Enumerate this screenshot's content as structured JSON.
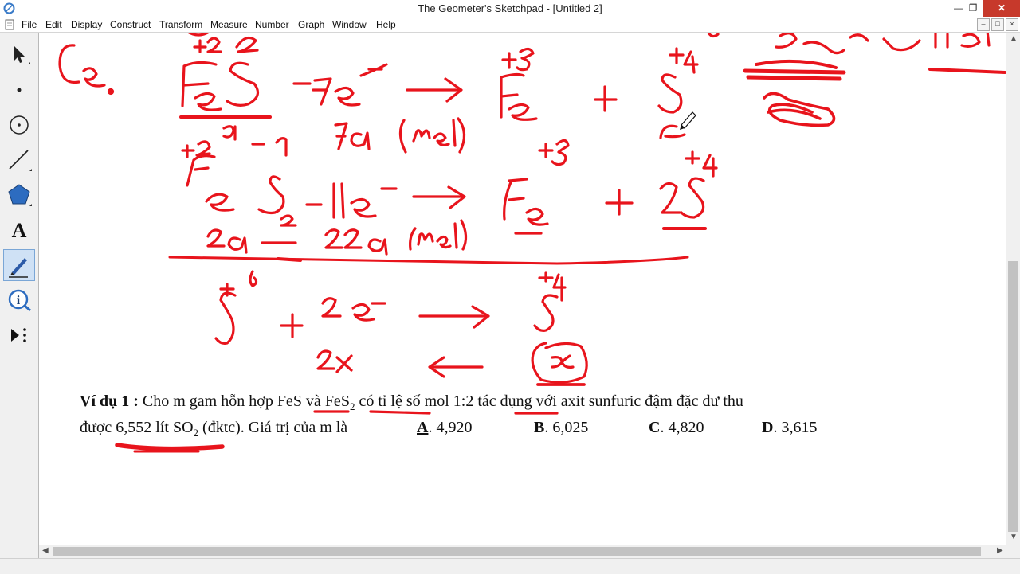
{
  "window": {
    "title": "The Geometer's Sketchpad - [Untitled 2]"
  },
  "menu": [
    "File",
    "Edit",
    "Display",
    "Construct",
    "Transform",
    "Measure",
    "Number",
    "Graph",
    "Window",
    "Help"
  ],
  "tools": [
    {
      "name": "arrow-tool"
    },
    {
      "name": "point-tool"
    },
    {
      "name": "compass-tool"
    },
    {
      "name": "straightedge-tool"
    },
    {
      "name": "polygon-tool"
    },
    {
      "name": "text-tool",
      "glyph": "A"
    },
    {
      "name": "marker-tool",
      "active": true
    },
    {
      "name": "information-tool",
      "glyph": "i"
    },
    {
      "name": "custom-tool"
    }
  ],
  "problem": {
    "label": "Ví dụ 1 :",
    "line1_rest": " Cho m gam hỗn hợp FeS và FeS",
    "sub2a": "2",
    "line1_tail": " có tỉ lệ số mol 1:2 tác dụng với axit sunfuric đậm đặc dư thu",
    "line2_a": "được 6,552 lít SO",
    "sub2b": "2",
    "line2_b": " (đktc). Giá trị của m là",
    "options": [
      {
        "letter": "A",
        "value": ". 4,920"
      },
      {
        "letter": "B",
        "value": ". 6,025"
      },
      {
        "letter": "C",
        "value": ". 4,820"
      },
      {
        "letter": "D",
        "value": ". 3,615"
      }
    ]
  },
  "colors": {
    "ink": "#e8141c",
    "accent_active": "#cfe1f5"
  }
}
